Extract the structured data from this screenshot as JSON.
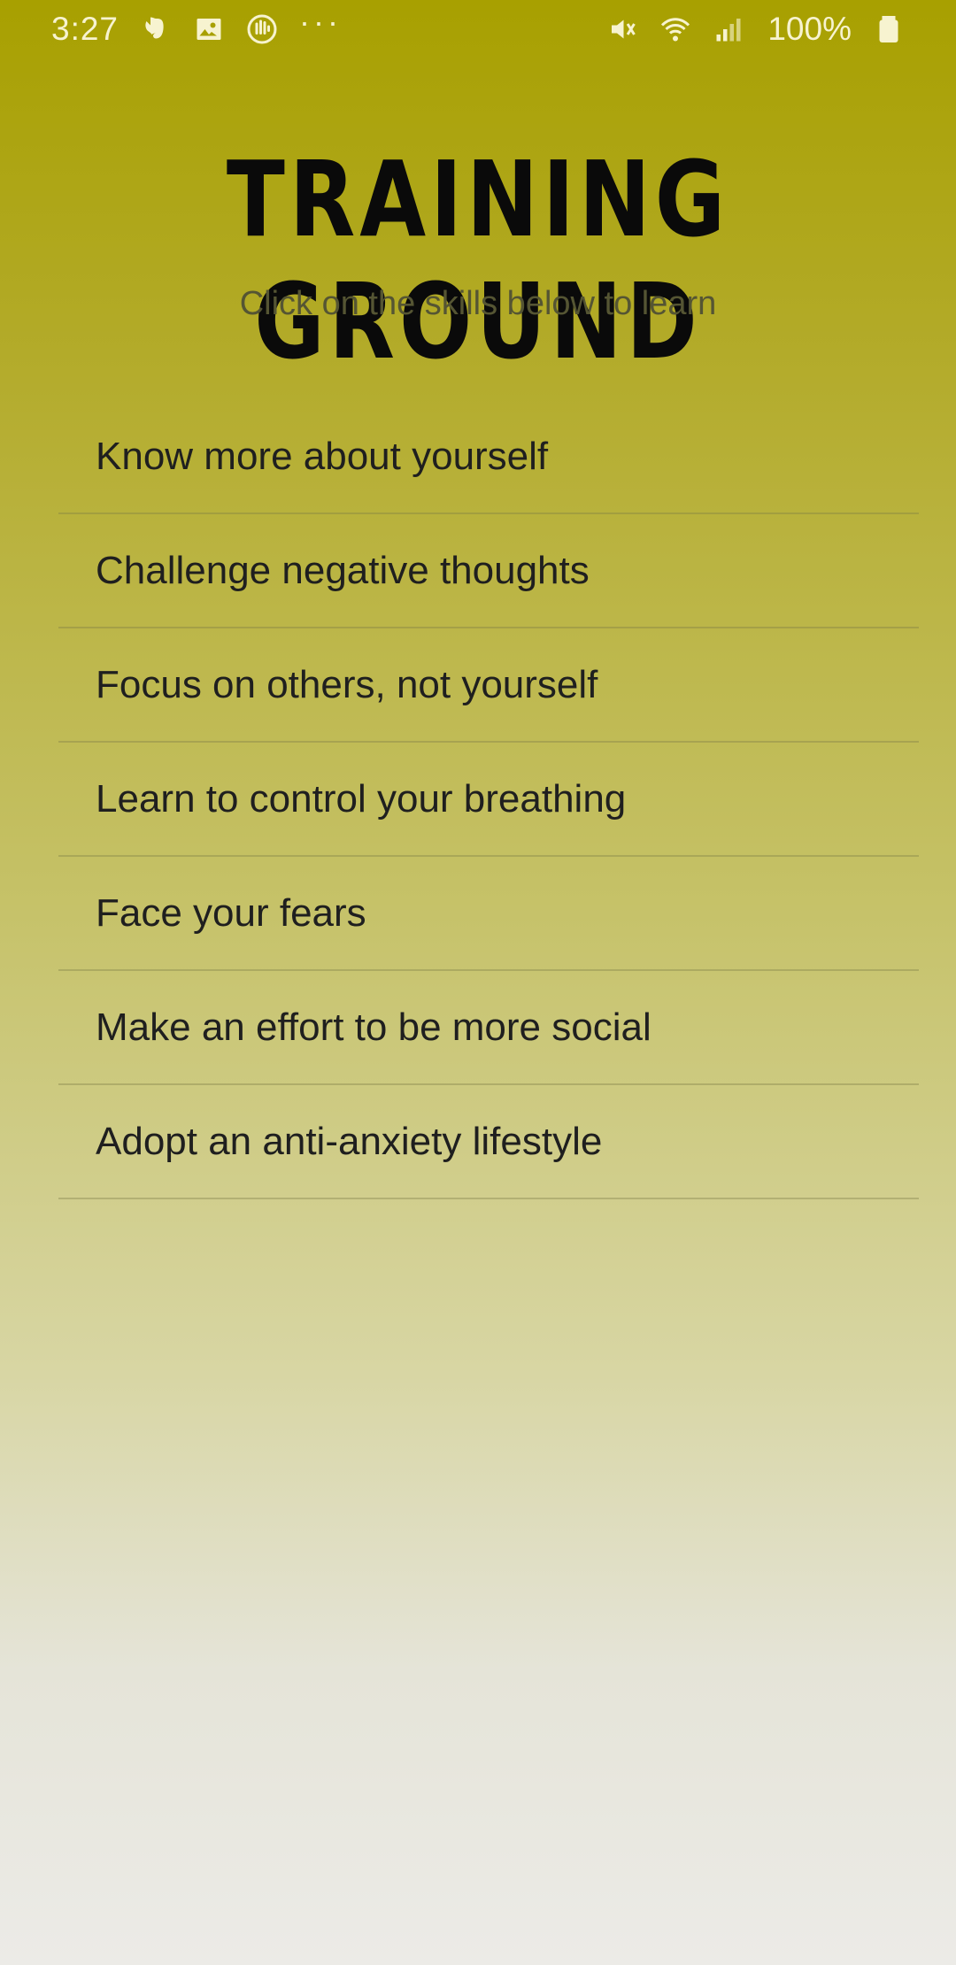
{
  "status_bar": {
    "time": "3:27",
    "left_icons": [
      "evernote-icon",
      "image-icon",
      "hand-icon",
      "more-dots-icon"
    ],
    "dots": "···",
    "battery_percent": "100%",
    "right_icons": [
      "vibrate-mute-icon",
      "wifi-icon",
      "signal-icon",
      "battery-icon"
    ]
  },
  "header": {
    "title": "TRAINING GROUND",
    "subtitle": "Click on the skills below to learn"
  },
  "skills": [
    {
      "label": "Know more about yourself"
    },
    {
      "label": "Challenge negative thoughts"
    },
    {
      "label": "Focus on others, not yourself"
    },
    {
      "label": "Learn to control your breathing"
    },
    {
      "label": "Face your fears"
    },
    {
      "label": "Make an effort to be more social"
    },
    {
      "label": "Adopt an anti-anxiety lifestyle"
    }
  ],
  "colors": {
    "gradient_top": "#a8a000",
    "gradient_bottom": "#ecebe7",
    "title": "#0a0a0a",
    "subtitle": "#555533",
    "item_text": "#1f1f1f",
    "status_text": "#f7f3d0"
  }
}
